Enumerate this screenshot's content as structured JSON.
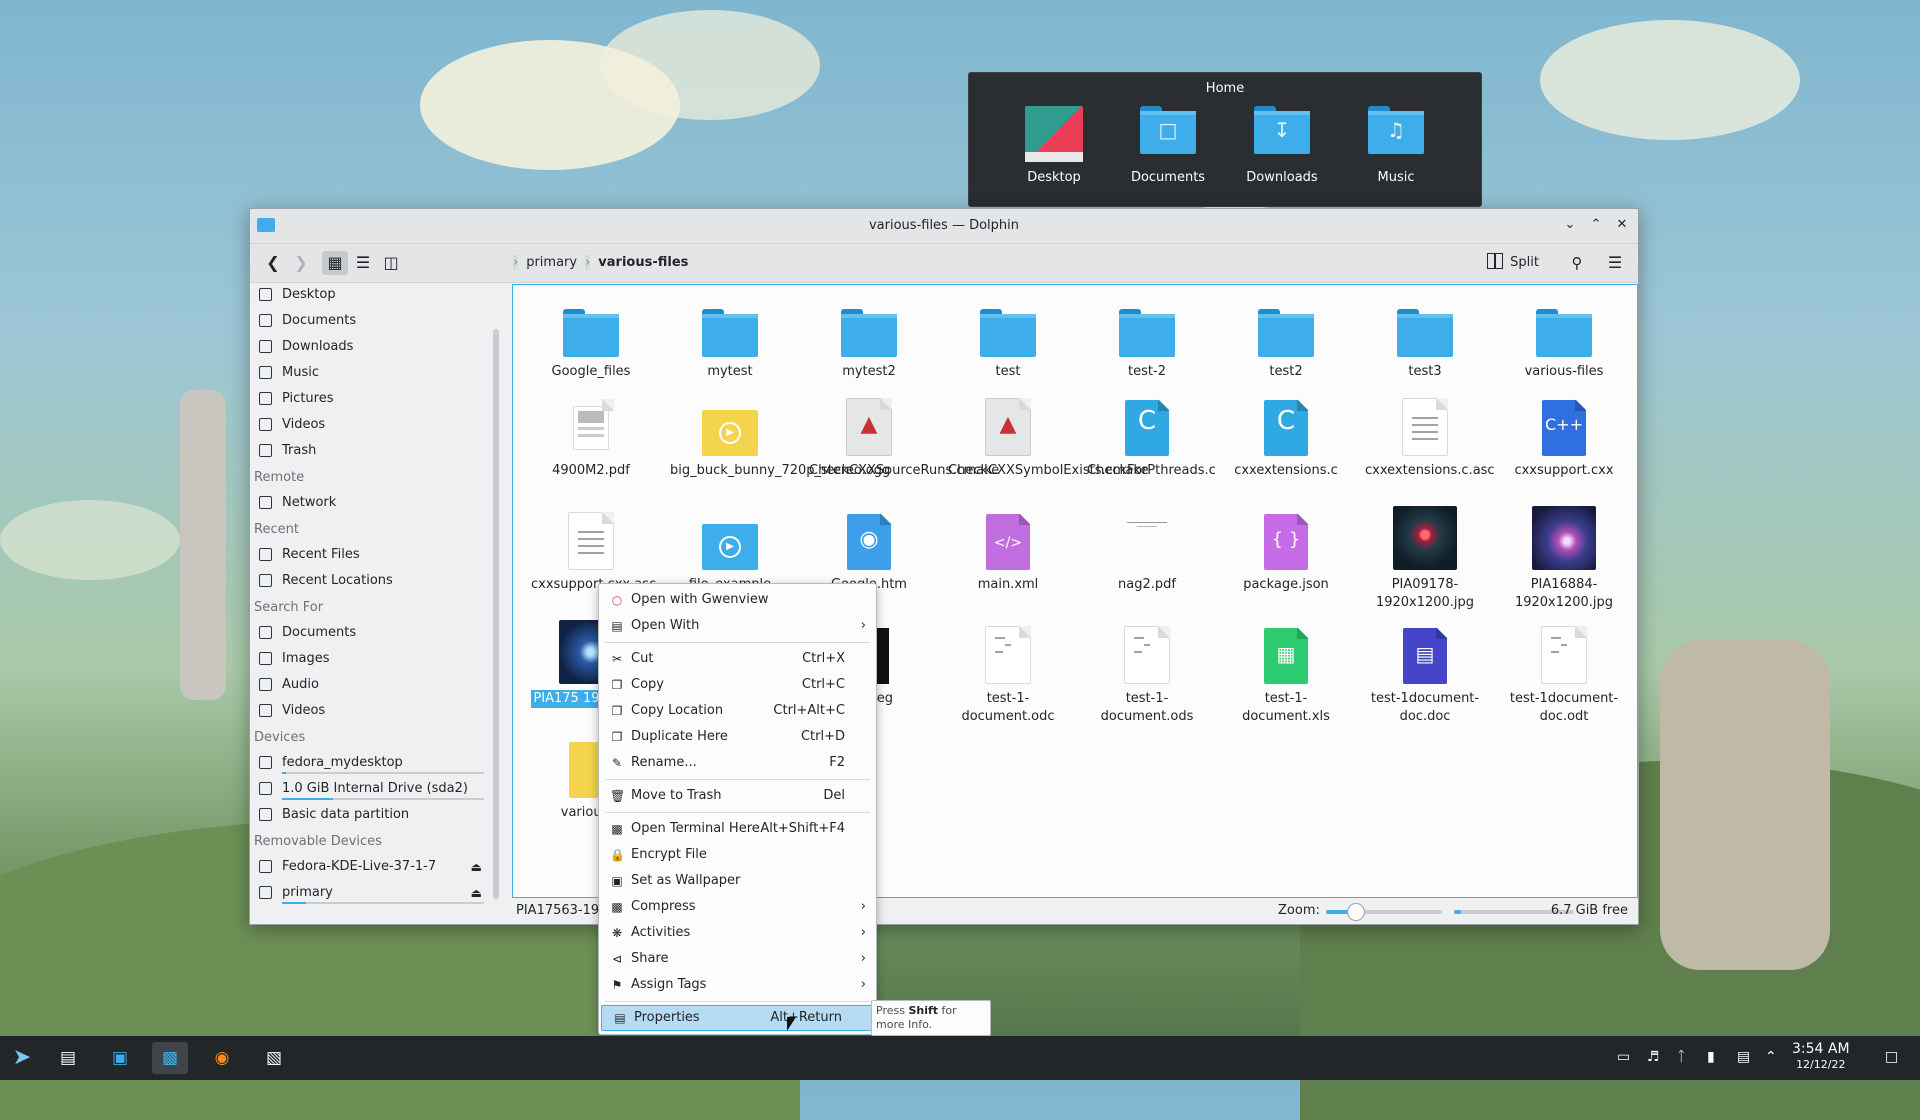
{
  "home_popup": {
    "title": "Home",
    "items": [
      {
        "label": "Desktop",
        "icon": "desktop-folder-icon"
      },
      {
        "label": "Documents",
        "icon": "documents-folder-icon"
      },
      {
        "label": "Downloads",
        "icon": "downloads-folder-icon"
      },
      {
        "label": "Music",
        "icon": "music-folder-icon"
      }
    ]
  },
  "window": {
    "title": "various-files — Dolphin",
    "breadcrumb": [
      "primary",
      "various-files"
    ],
    "split_label": "Split"
  },
  "sidebar": {
    "places": [
      {
        "label": "Desktop"
      },
      {
        "label": "Documents"
      },
      {
        "label": "Downloads"
      },
      {
        "label": "Music"
      },
      {
        "label": "Pictures"
      },
      {
        "label": "Videos"
      },
      {
        "label": "Trash"
      }
    ],
    "remote_header": "Remote",
    "remote": [
      {
        "label": "Network"
      }
    ],
    "recent_header": "Recent",
    "recent": [
      {
        "label": "Recent Files"
      },
      {
        "label": "Recent Locations"
      }
    ],
    "search_header": "Search For",
    "search": [
      {
        "label": "Documents"
      },
      {
        "label": "Images"
      },
      {
        "label": "Audio"
      },
      {
        "label": "Videos"
      }
    ],
    "devices_header": "Devices",
    "devices": [
      {
        "label": "fedora_mydesktop",
        "usage": 0.02
      },
      {
        "label": "1.0 GiB Internal Drive (sda2)",
        "usage": 0.25
      },
      {
        "label": "Basic data partition"
      }
    ],
    "removable_header": "Removable Devices",
    "removable": [
      {
        "label": "Fedora-KDE-Live-37-1-7"
      },
      {
        "label": "primary",
        "usage": 0.12
      }
    ]
  },
  "files": [
    {
      "name": "Google_files",
      "type": "folder"
    },
    {
      "name": "mytest",
      "type": "folder"
    },
    {
      "name": "mytest2",
      "type": "folder"
    },
    {
      "name": "test",
      "type": "folder"
    },
    {
      "name": "test-2",
      "type": "folder"
    },
    {
      "name": "test2",
      "type": "folder"
    },
    {
      "name": "test3",
      "type": "folder"
    },
    {
      "name": "various-files",
      "type": "folder"
    },
    {
      "name": "4900M2.pdf",
      "type": "pdf"
    },
    {
      "name": "big_buck_bunny_720p_stereo.ogg",
      "type": "audio"
    },
    {
      "name": "CheckCXXSourceRuns.cmake",
      "type": "cmake"
    },
    {
      "name": "CheckCXXSymbolExists.cmake",
      "type": "cmake"
    },
    {
      "name": "CheckForPthreads.c",
      "type": "c"
    },
    {
      "name": "cxxextensions.c",
      "type": "c"
    },
    {
      "name": "cxxextensions.c.asc",
      "type": "text"
    },
    {
      "name": "cxxsupport.cxx",
      "type": "cxx"
    },
    {
      "name": "cxxsupport.cxx.asc",
      "type": "text"
    },
    {
      "name": "file_example",
      "type": "video"
    },
    {
      "name": "Google.htm",
      "type": "html"
    },
    {
      "name": "main.xml",
      "type": "xml"
    },
    {
      "name": "nag2.pdf",
      "type": "pdf2"
    },
    {
      "name": "package.json",
      "type": "json"
    },
    {
      "name": "PIA09178-1920x1200.jpg",
      "type": "nebula"
    },
    {
      "name": "PIA16884-1920x1200.jpg",
      "type": "galaxy"
    },
    {
      "name": "PIA17563-1920x1200.jpg",
      "type": "blue",
      "label_visible": "PIA175 1920x120"
    },
    {
      "name": "ve.jpeg",
      "type": "bw",
      "label_visible": "ve.jpeg"
    },
    {
      "name": "test-1-document.odc",
      "type": "odc"
    },
    {
      "name": "test-1-document.ods",
      "type": "ods"
    },
    {
      "name": "test-1-document.xls",
      "type": "xls"
    },
    {
      "name": "test-1document-doc.doc",
      "type": "doc"
    },
    {
      "name": "test-1document-doc.odt",
      "type": "odt"
    },
    {
      "name": "various-fi",
      "type": "yellow",
      "label_visible": "various-fi"
    }
  ],
  "status": {
    "selected": "PIA17563-192",
    "zoom_label": "Zoom:",
    "zoom_level": 0.25,
    "free_space_fraction": 0.06,
    "free_label": "6.7 GiB free"
  },
  "context_menu": [
    {
      "label": "Open with Gwenview",
      "icon": "gwenview-icon"
    },
    {
      "label": "Open With",
      "submenu": true,
      "icon": "open-with-icon"
    },
    {
      "separator": true
    },
    {
      "label": "Cut",
      "shortcut": "Ctrl+X",
      "icon": "cut-icon"
    },
    {
      "label": "Copy",
      "shortcut": "Ctrl+C",
      "icon": "copy-icon"
    },
    {
      "label": "Copy Location",
      "shortcut": "Ctrl+Alt+C",
      "icon": "copy-location-icon"
    },
    {
      "label": "Duplicate Here",
      "shortcut": "Ctrl+D",
      "icon": "duplicate-icon"
    },
    {
      "label": "Rename...",
      "shortcut": "F2",
      "icon": "rename-icon"
    },
    {
      "separator": true
    },
    {
      "label": "Move to Trash",
      "shortcut": "Del",
      "icon": "trash-icon"
    },
    {
      "separator": true
    },
    {
      "label": "Open Terminal Here",
      "shortcut": "Alt+Shift+F4",
      "icon": "terminal-icon"
    },
    {
      "label": "Encrypt File",
      "icon": "lock-icon"
    },
    {
      "label": "Set as Wallpaper",
      "icon": "wallpaper-icon"
    },
    {
      "label": "Compress",
      "submenu": true,
      "icon": "compress-icon"
    },
    {
      "label": "Activities",
      "submenu": true,
      "icon": "activities-icon"
    },
    {
      "label": "Share",
      "submenu": true,
      "icon": "share-icon"
    },
    {
      "label": "Assign Tags",
      "submenu": true,
      "icon": "tag-icon"
    },
    {
      "separator": true
    },
    {
      "label": "Properties",
      "shortcut": "Alt+Return",
      "icon": "properties-icon",
      "highlighted": true
    }
  ],
  "tooltip": {
    "prefix": "Press ",
    "key": "Shift",
    "suffix": " for more Info."
  },
  "taskbar": {
    "time": "3:54 AM",
    "date": "12/12/22"
  },
  "colors": {
    "accent": "#3daee9",
    "panel": "#232629",
    "window": "#eff0f1"
  }
}
